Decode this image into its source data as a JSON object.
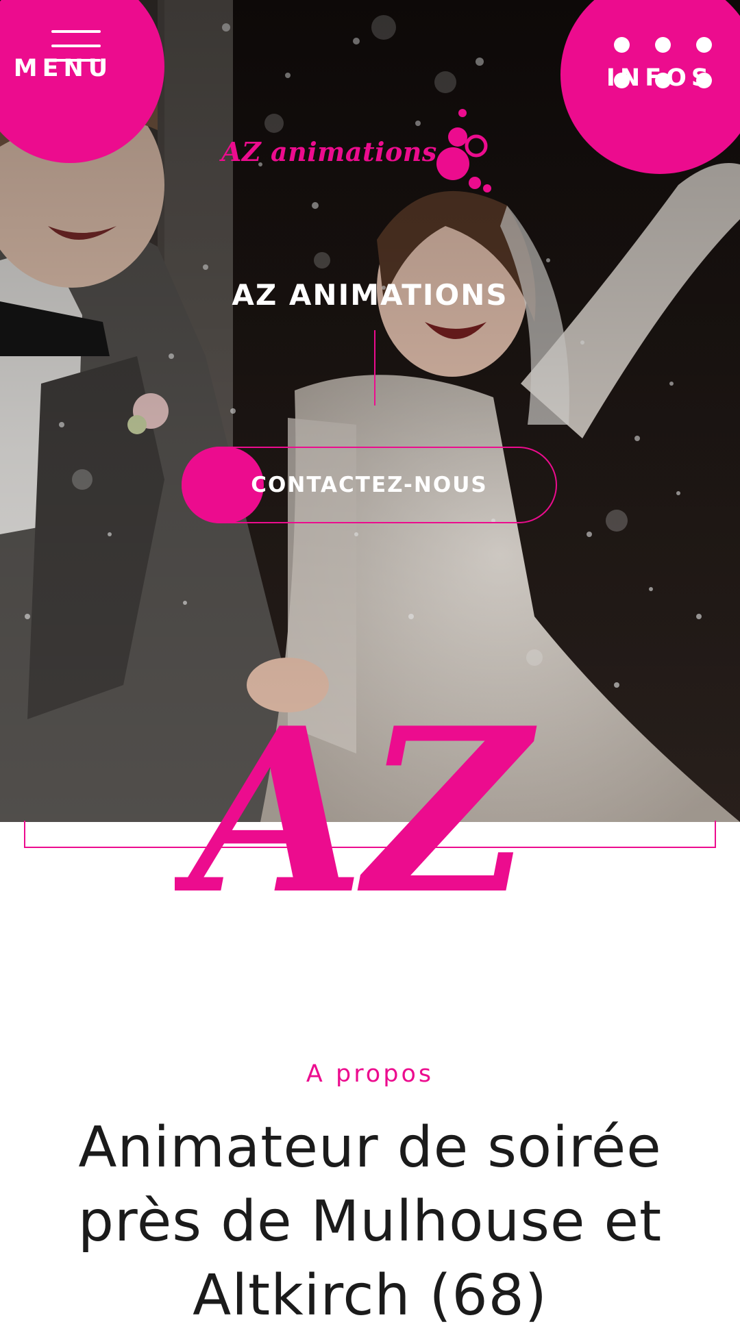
{
  "theme": {
    "accent": "#ec0c8e",
    "text_dark": "#1b1b1b"
  },
  "nav": {
    "menu_label": "MENU",
    "infos_label": "INFOS",
    "menu_icon": "hamburger-icon",
    "infos_icon": "grid-dots-icon"
  },
  "brand": {
    "logo_text": "AZ animations",
    "monogram": "AZ"
  },
  "hero": {
    "title": "AZ ANIMATIONS",
    "cta_label": "CONTACTEZ-NOUS"
  },
  "about": {
    "eyebrow": "A propos",
    "heading": "Animateur de soirée près de Mulhouse et Altkirch (68)"
  }
}
